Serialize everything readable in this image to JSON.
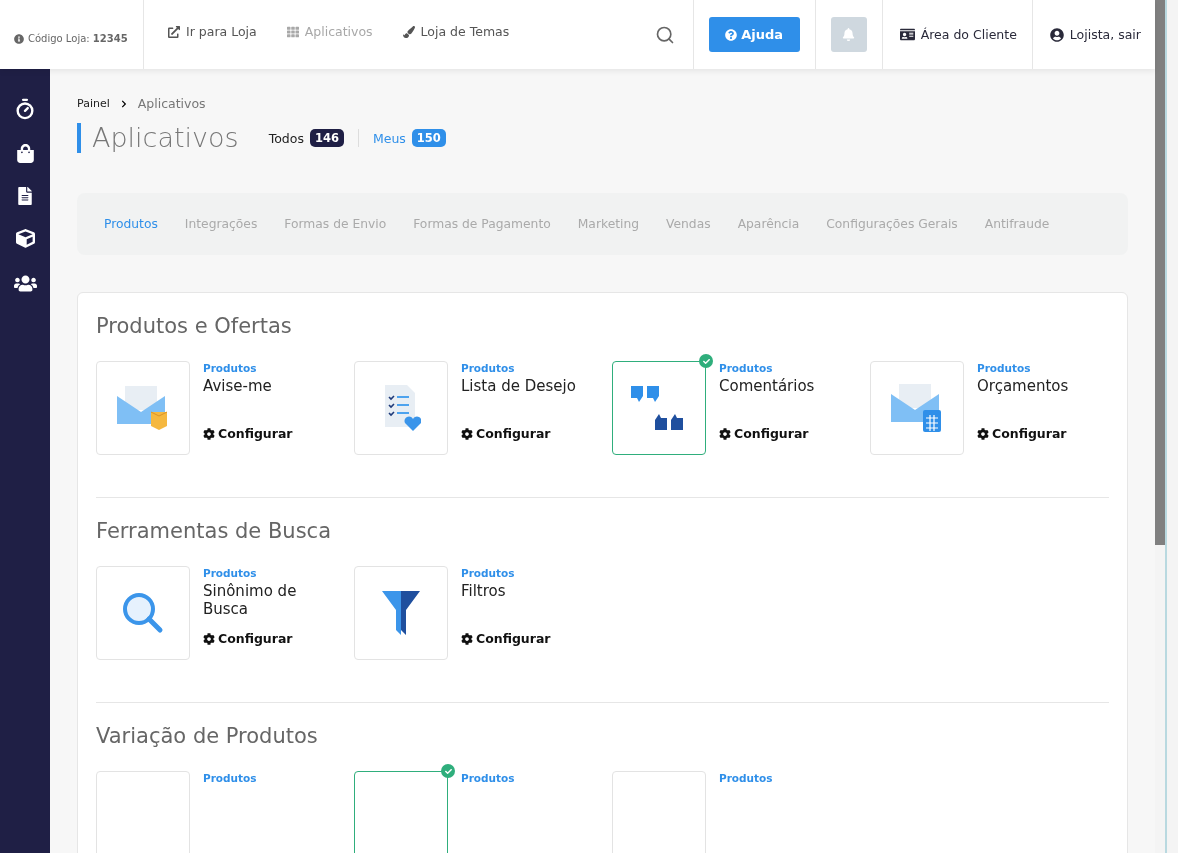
{
  "header": {
    "store_code": "Código Loja: **12345**",
    "nav": [
      {
        "label": "Ir para Loja",
        "kind": "external",
        "selected": false
      },
      {
        "label": "Aplicativos",
        "kind": "grid",
        "selected": true
      },
      {
        "label": "Loja de Temas",
        "kind": "brush",
        "selected": false
      }
    ],
    "help_button": "Ajuda",
    "client_area": "Área do Cliente",
    "logout": "Lojista, sair"
  },
  "breadcrumb": [
    "Painel",
    "Aplicativos"
  ],
  "title": "Aplicativos",
  "filters": [
    {
      "label": "Todos",
      "count": "146",
      "selected": true
    },
    {
      "label": "Meus",
      "count": "150",
      "selected": false
    }
  ],
  "tabs": [
    {
      "label": "Produtos",
      "selected": true
    },
    {
      "label": "Integrações",
      "selected": false
    },
    {
      "label": "Formas de Envio",
      "selected": false
    },
    {
      "label": "Formas de Pagamento",
      "selected": false
    },
    {
      "label": "Marketing",
      "selected": false
    },
    {
      "label": "Vendas",
      "selected": false
    },
    {
      "label": "Aparência",
      "selected": false
    },
    {
      "label": "Configurações Gerais",
      "selected": false
    },
    {
      "label": "Antifraude",
      "selected": false
    }
  ],
  "sections": [
    {
      "title": "Produtos e Ofertas",
      "apps": [
        {
          "kind": "mail-box",
          "category": "Produtos",
          "name": "Avise-me",
          "action": "Configurar",
          "installed": false
        },
        {
          "kind": "wishlist",
          "category": "Produtos",
          "name": "Lista de Desejo",
          "action": "Configurar",
          "installed": false
        },
        {
          "kind": "quotes",
          "category": "Produtos",
          "name": "Comentários",
          "action": "Configurar",
          "installed": true
        },
        {
          "kind": "mail-calculator",
          "category": "Produtos",
          "name": "Orçamentos",
          "action": "Configurar",
          "installed": false
        }
      ]
    },
    {
      "title": "Ferramentas de Busca",
      "apps": [
        {
          "kind": "magnifier",
          "category": "Produtos",
          "name": "Sinônimo de Busca",
          "action": "Configurar",
          "installed": false
        },
        {
          "kind": "funnel",
          "category": "Produtos",
          "name": "Filtros",
          "action": "Configurar",
          "installed": false
        }
      ]
    },
    {
      "title": "Variação de Produtos",
      "apps": [
        {
          "category": "Produtos",
          "installed": false
        },
        {
          "category": "Produtos",
          "installed": true
        },
        {
          "category": "Produtos",
          "installed": false
        }
      ]
    }
  ]
}
